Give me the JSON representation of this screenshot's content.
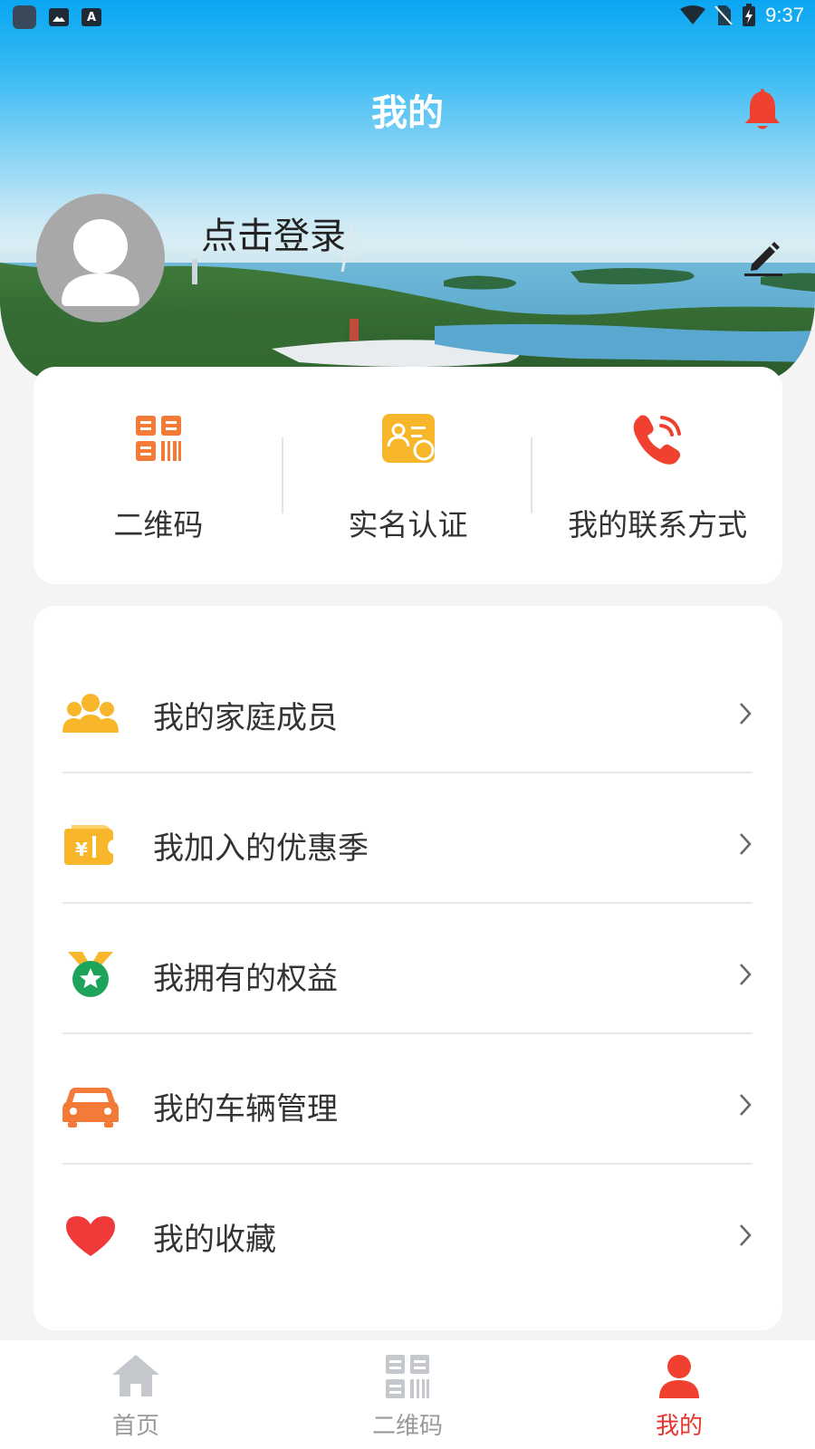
{
  "status_bar": {
    "time": "9:37",
    "left_icons": [
      "app-icon",
      "image-icon",
      "a-icon"
    ],
    "right_icons": [
      "wifi-icon",
      "no-sim-icon",
      "battery-charging-icon"
    ]
  },
  "header": {
    "title": "我的",
    "bell_icon": "bell-icon",
    "accent": "#f04030"
  },
  "profile": {
    "login_text": "点击登录",
    "avatar_icon": "user-avatar-icon",
    "edit_icon": "pencil-icon"
  },
  "quick_actions": [
    {
      "label": "二维码",
      "icon": "qrcode-icon",
      "color": "#f47a38"
    },
    {
      "label": "实名认证",
      "icon": "id-card-icon",
      "color": "#f8b62b"
    },
    {
      "label": "我的联系方式",
      "icon": "phone-icon",
      "color": "#f04030"
    }
  ],
  "menu": [
    {
      "label": "我的家庭成员",
      "icon": "family-icon",
      "color": "#f8b62b"
    },
    {
      "label": "我加入的优惠季",
      "icon": "coupon-icon",
      "color": "#f8b62b"
    },
    {
      "label": "我拥有的权益",
      "icon": "medal-icon",
      "color": "#1ea35a"
    },
    {
      "label": "我的车辆管理",
      "icon": "car-icon",
      "color": "#f47a38"
    },
    {
      "label": "我的收藏",
      "icon": "heart-icon",
      "color": "#f03a3a"
    }
  ],
  "bottom_nav": [
    {
      "label": "首页",
      "icon": "home-icon",
      "active": false
    },
    {
      "label": "二维码",
      "icon": "qrcode-icon",
      "active": false
    },
    {
      "label": "我的",
      "icon": "user-icon",
      "active": true
    }
  ]
}
